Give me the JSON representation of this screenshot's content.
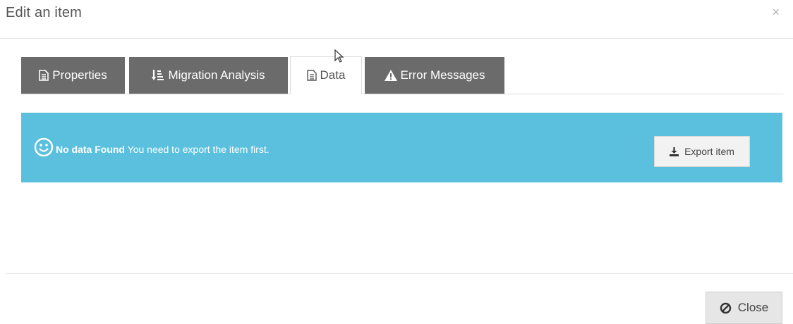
{
  "modal": {
    "title": "Edit an item",
    "close_symbol": "×"
  },
  "tabs": [
    {
      "label": "Properties",
      "icon": "document-icon",
      "active": false
    },
    {
      "label": "Migration Analysis",
      "icon": "sort-icon",
      "active": false
    },
    {
      "label": "Data",
      "icon": "document-icon",
      "active": true
    },
    {
      "label": "Error Messages",
      "icon": "warning-icon",
      "active": false
    }
  ],
  "alert": {
    "icon": "smiley-icon",
    "strong": "No data Found",
    "message": " You need to export the item first.",
    "button_label": "Export item",
    "button_icon": "download-icon"
  },
  "footer": {
    "close_label": "Close",
    "close_icon": "ban-icon"
  },
  "colors": {
    "alert_bg": "#5bc0de",
    "tab_dark": "#6b6b6b"
  }
}
